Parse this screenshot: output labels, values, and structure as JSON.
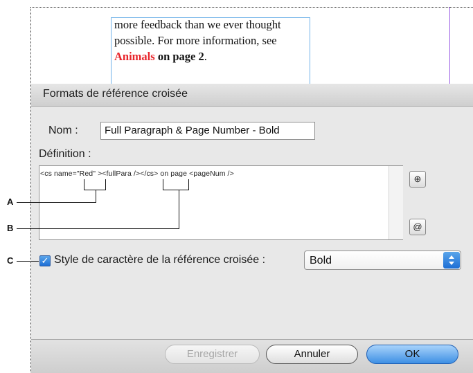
{
  "document": {
    "line1": "more feedback than we ever thought",
    "line2": "possible. For more information, see",
    "xref_red": "Animals",
    "xref_bold": " on page 2",
    "period": "."
  },
  "dialog": {
    "title": "Formats de référence croisée",
    "name_label": "Nom :",
    "name_value": "Full Paragraph & Page Number - Bold",
    "definition_label": "Définition :",
    "definition_value": "<cs name=\"Red\" ><fullPara /></cs> on page <pageNum />",
    "insert_text_button_icon": "⊕",
    "insert_special_button_icon": "@",
    "char_style_checkbox_checked": true,
    "char_style_label": "Style de caractère de la référence croisée :",
    "char_style_value": "Bold",
    "buttons": {
      "save": "Enregistrer",
      "cancel": "Annuler",
      "ok": "OK"
    }
  },
  "callouts": {
    "a": "A",
    "b": "B",
    "c": "C"
  },
  "colors": {
    "xref_red": "#e8242b",
    "accent_blue": "#3d8fe4",
    "frame_blue": "#6fb1e8",
    "guide_purple": "#9b5de5"
  },
  "icons": {
    "checkbox": "checkmark-icon",
    "select_arrows": "updown-arrows-icon"
  }
}
